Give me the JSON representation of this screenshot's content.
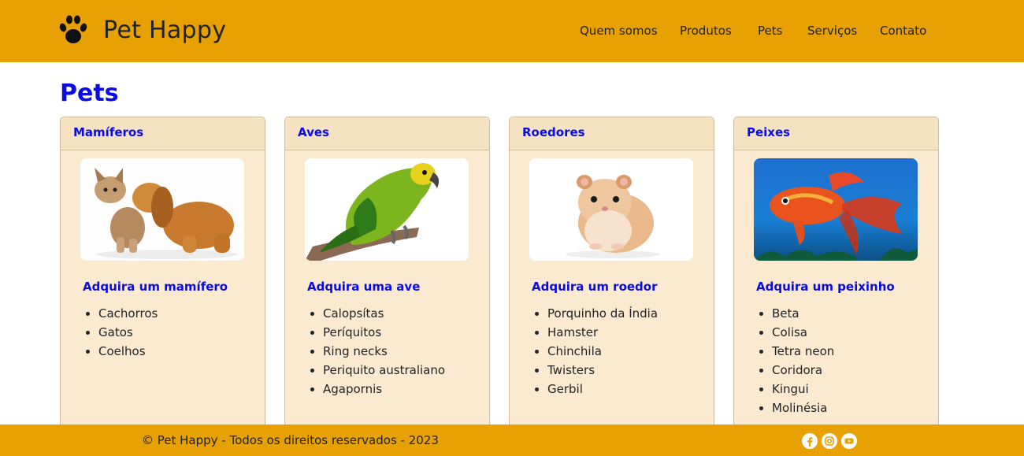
{
  "header": {
    "brand_name": "Pet Happy",
    "logo_icon": "paw-icon",
    "bg_color": "#e7a103",
    "nav": [
      {
        "label": "Quem somos"
      },
      {
        "label": "Produtos"
      },
      {
        "label": "Pets"
      },
      {
        "label": "Serviços"
      },
      {
        "label": "Contato"
      }
    ]
  },
  "main": {
    "title": "Pets",
    "title_color": "#0a0ae6",
    "cards": [
      {
        "title": "Mamíferos",
        "image": "kitten-and-puppy",
        "subtitle": "Adquira um mamífero",
        "items": [
          "Cachorros",
          "Gatos",
          "Coelhos"
        ]
      },
      {
        "title": "Aves",
        "image": "parrot",
        "subtitle": "Adquira uma ave",
        "items": [
          "Calopsítas",
          "Períquitos",
          "Ring necks",
          "Periquito australiano",
          "Agapornis"
        ]
      },
      {
        "title": "Roedores",
        "image": "hamster",
        "subtitle": "Adquira um roedor",
        "items": [
          "Porquinho da Índia",
          "Hamster",
          "Chinchila",
          "Twisters",
          "Gerbil"
        ]
      },
      {
        "title": "Peixes",
        "image": "goldfish",
        "subtitle": "Adquira um peixinho",
        "items": [
          "Beta",
          "Colisa",
          "Tetra neon",
          "Coridora",
          "Kingui",
          "Molinésia"
        ]
      }
    ]
  },
  "footer": {
    "copyright": "© Pet Happy - Todos os direitos reservados - 2023",
    "social": [
      "facebook-icon",
      "instagram-icon",
      "youtube-icon"
    ]
  }
}
